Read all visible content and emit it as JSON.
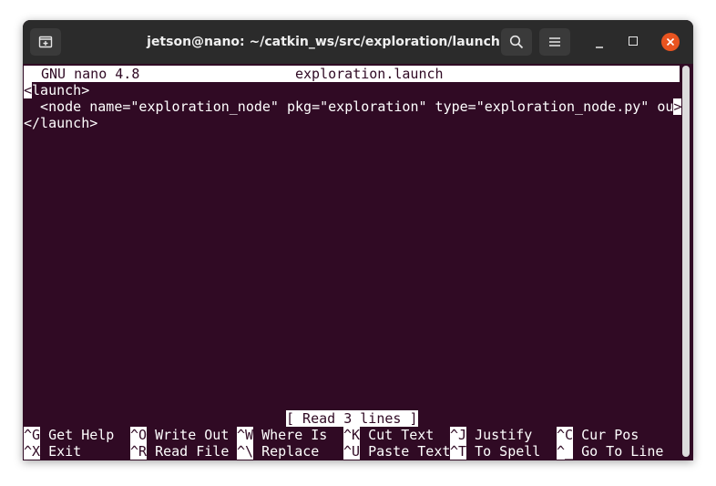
{
  "window": {
    "title": "jetson@nano: ~/catkin_ws/src/exploration/launch",
    "icons": {
      "new_tab": "new-tab-icon",
      "search": "search-icon",
      "menu": "hamburger-menu-icon",
      "minimize": "minimize-icon",
      "maximize": "maximize-icon",
      "close": "close-icon"
    },
    "colors": {
      "titlebar": "#2b2b2b",
      "terminal_bg": "#300a24",
      "close_button": "#e95420"
    }
  },
  "nano": {
    "version": "GNU nano 4.8",
    "filename": "exploration.launch",
    "content": {
      "line1_cursor": "<",
      "line1_rest": "launch>",
      "line2_text": "  <node name=\"exploration_node\" pkg=\"exploration\" type=\"exploration_node.py\" ou",
      "line2_overflow": ">",
      "line3": "</launch>"
    },
    "status": "[ Read 3 lines ]",
    "shortcuts": [
      {
        "key": "^G",
        "label": " Get Help"
      },
      {
        "key": "^O",
        "label": " Write Out"
      },
      {
        "key": "^W",
        "label": " Where Is"
      },
      {
        "key": "^K",
        "label": " Cut Text"
      },
      {
        "key": "^J",
        "label": " Justify"
      },
      {
        "key": "^C",
        "label": " Cur Pos"
      },
      {
        "key": "^X",
        "label": " Exit"
      },
      {
        "key": "^R",
        "label": " Read File"
      },
      {
        "key": "^\\",
        "label": " Replace"
      },
      {
        "key": "^U",
        "label": " Paste Text"
      },
      {
        "key": "^T",
        "label": " To Spell"
      },
      {
        "key": "^_",
        "label": " Go To Line"
      }
    ]
  }
}
